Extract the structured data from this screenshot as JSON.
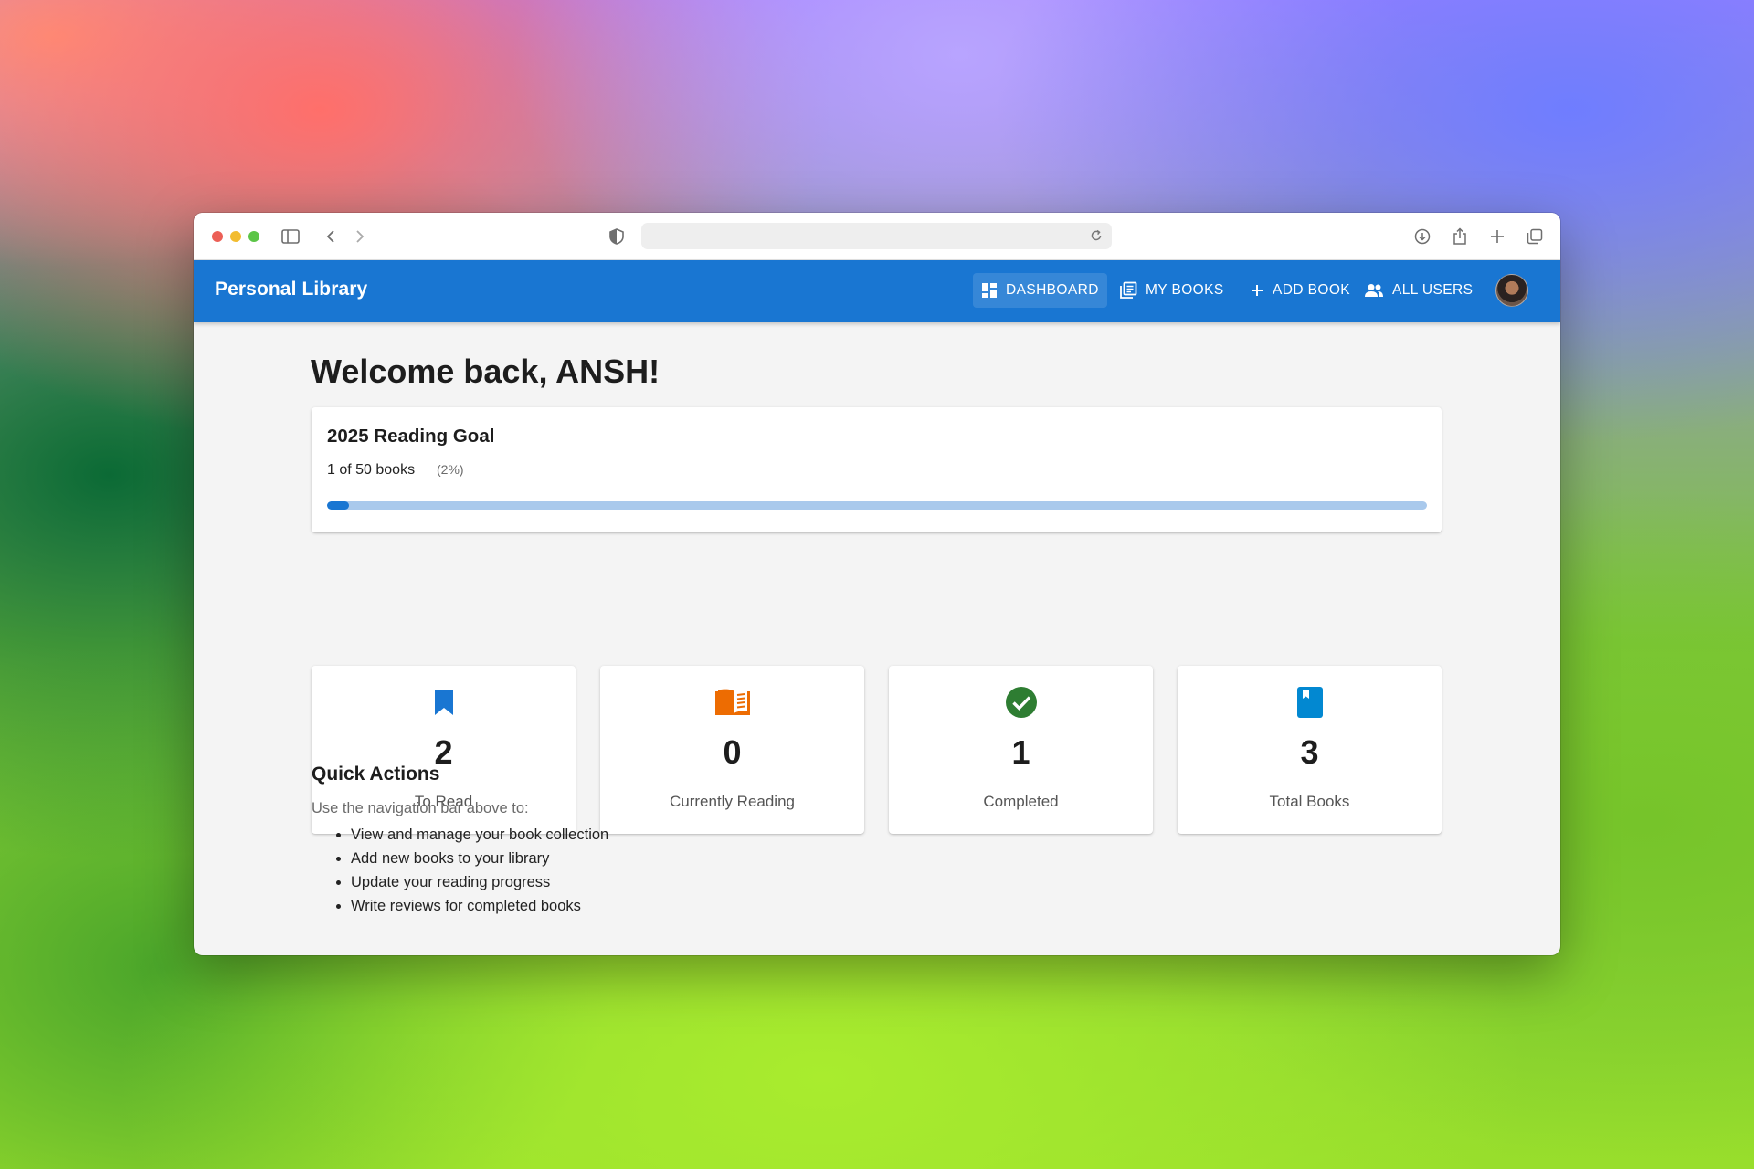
{
  "app": {
    "brand": "Personal Library",
    "brand_color": "#1976d2"
  },
  "nav": {
    "items": [
      {
        "label": "DASHBOARD",
        "icon": "dashboard-icon",
        "active": true
      },
      {
        "label": "MY BOOKS",
        "icon": "library-books-icon",
        "active": false
      },
      {
        "label": "ADD BOOK",
        "icon": "plus-icon",
        "active": false
      },
      {
        "label": "ALL USERS",
        "icon": "people-icon",
        "active": false
      }
    ],
    "avatar": "user-avatar"
  },
  "dashboard": {
    "welcome": "Welcome back, ANSH!",
    "goal": {
      "title": "2025 Reading Goal",
      "count_text": "1 of 50 books",
      "percent_text": "(2%)",
      "progress_fraction": 0.02
    },
    "stats": [
      {
        "value": "2",
        "label": "To Read",
        "icon": "bookmark-icon",
        "color": "#1976d2"
      },
      {
        "value": "0",
        "label": "Currently Reading",
        "icon": "open-book-icon",
        "color": "#ed6c02"
      },
      {
        "value": "1",
        "label": "Completed",
        "icon": "check-circle-icon",
        "color": "#2e7d32"
      },
      {
        "value": "3",
        "label": "Total Books",
        "icon": "book-icon",
        "color": "#0288d1"
      }
    ],
    "quick_actions": {
      "title": "Quick Actions",
      "subtitle": "Use the navigation bar above to:",
      "items": [
        "View and manage your book collection",
        "Add new books to your library",
        "Update your reading progress",
        "Write reviews for completed books"
      ]
    }
  }
}
